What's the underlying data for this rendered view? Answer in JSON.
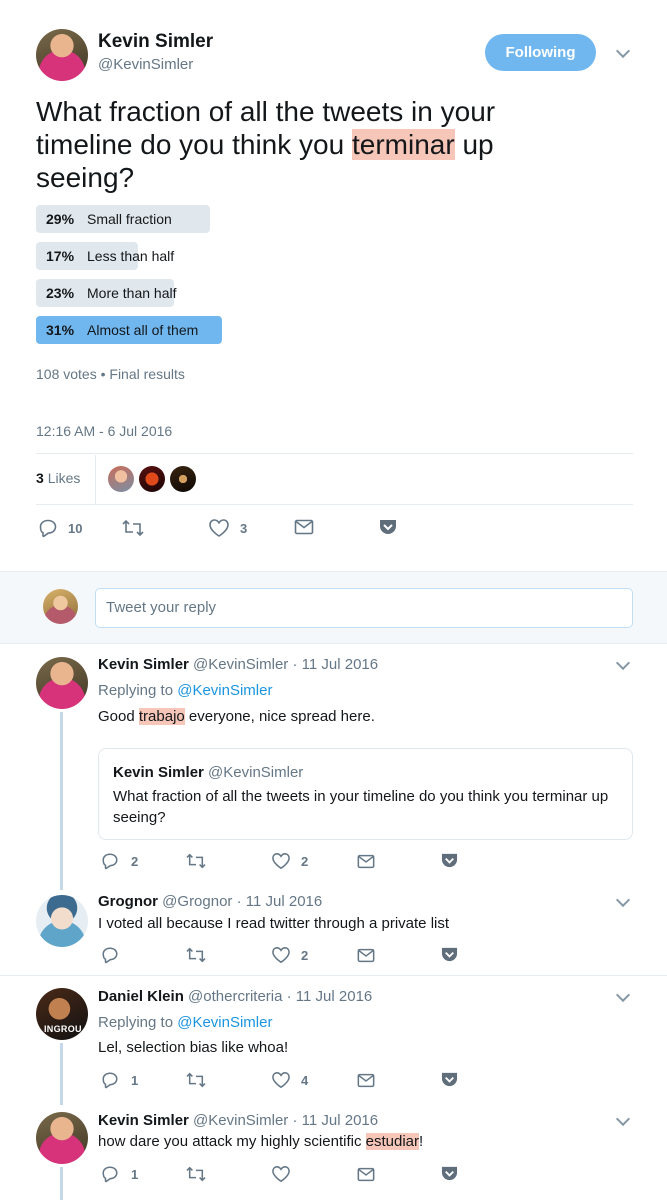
{
  "main_tweet": {
    "author_name": "Kevin Simler",
    "author_handle": "@KevinSimler",
    "follow_label": "Following",
    "text_before": "What fraction of all the tweets in your timeline do you think you ",
    "text_highlight": "terminar",
    "text_after": " up seeing?",
    "poll": [
      {
        "percent": "29%",
        "label": "Small fraction",
        "value": 29,
        "winner": false
      },
      {
        "percent": "17%",
        "label": "Less than half",
        "value": 17,
        "winner": false
      },
      {
        "percent": "23%",
        "label": "More than half",
        "value": 23,
        "winner": false
      },
      {
        "percent": "31%",
        "label": "Almost all of them",
        "value": 31,
        "winner": true
      }
    ],
    "poll_summary": "108 votes • Final results",
    "timestamp": "12:16 AM - 6 Jul 2016",
    "likes_count": "3",
    "likes_label": "Likes",
    "actions": {
      "reply_count": "10",
      "like_count": "3"
    }
  },
  "reply_box": {
    "placeholder": "Tweet your reply"
  },
  "replies": [
    {
      "name": "Kevin Simler",
      "handle": "@KevinSimler",
      "date": "· 11 Jul 2016",
      "replying_prefix": "Replying to ",
      "replying_to": "@KevinSimler",
      "text_before": "Good ",
      "text_highlight": "trabajo",
      "text_after": " everyone, nice spread here.",
      "quote": {
        "name": "Kevin Simler",
        "handle": "@KevinSimler",
        "text": "What fraction of all the tweets in your timeline do you think you terminar up seeing?"
      },
      "reply_count": "2",
      "like_count": "2"
    },
    {
      "name": "Grognor",
      "handle": "@Grognor",
      "date": "· 11 Jul 2016",
      "text": "I voted all because I read twitter through a private list",
      "like_count": "2"
    },
    {
      "name": "Daniel Klein",
      "handle": "@othercriteria",
      "date": "· 11 Jul 2016",
      "replying_prefix": "Replying to ",
      "replying_to": "@KevinSimler",
      "text": "Lel, selection bias like whoa!",
      "avatar_text": "INGROU",
      "reply_count": "1",
      "like_count": "4"
    },
    {
      "name": "Kevin Simler",
      "handle": "@KevinSimler",
      "date": "· 11 Jul 2016",
      "text_before": "how dare you attack my highly scientific ",
      "text_highlight": "estudiar",
      "text_after": "!",
      "reply_count": "1"
    }
  ],
  "colors": {
    "accent": "#1b95e0",
    "follow_button": "#71b7ef",
    "poll_winner": "#71b7ef",
    "poll_bar": "#e1e8ed",
    "highlight": "#f6c6b8",
    "thread_line": "#c4d8ea"
  }
}
